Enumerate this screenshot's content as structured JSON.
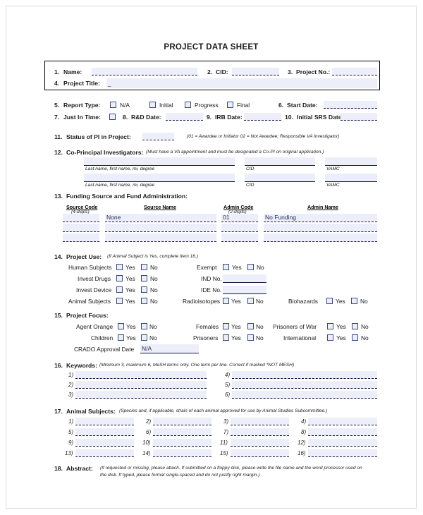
{
  "document": {
    "title": "PROJECT DATA SHEET"
  },
  "colors": {
    "field_fill": "#eceffa",
    "rule": "#14143c",
    "checkbox_border": "#3b4a7a",
    "page_border": "#dadada"
  },
  "header_box": {
    "item1": {
      "number": "1.",
      "label": "Name:",
      "value": ""
    },
    "item2": {
      "number": "2.",
      "label": "CID:",
      "value": ""
    },
    "item3": {
      "number": "3.",
      "label": "Project No.:",
      "value": ""
    },
    "item4": {
      "number": "4.",
      "label": "Project Title:",
      "value": "_"
    }
  },
  "item5": {
    "number": "5.",
    "label": "Report Type:",
    "options": [
      {
        "label": "N/A",
        "checked": false
      },
      {
        "label": "Initial",
        "checked": false
      },
      {
        "label": "Progress",
        "checked": false
      },
      {
        "label": "Final",
        "checked": false
      }
    ]
  },
  "item6": {
    "number": "6.",
    "label": "Start Date:",
    "value": ""
  },
  "item7": {
    "number": "7.",
    "label": "Just In Time:",
    "checked": false
  },
  "item8": {
    "number": "8.",
    "label": "R&D Date:",
    "value": ""
  },
  "item9": {
    "number": "9.",
    "label": "IRB Date:",
    "value": ""
  },
  "item10": {
    "number": "10.",
    "label": "Initial SRS Date:",
    "value": ""
  },
  "item11": {
    "number": "11.",
    "label": "Status of PI in Project:",
    "value": "",
    "note": "(01 = Awardee or Initiator 02 = Not Awardee; Responsible VA Investigator)"
  },
  "item12": {
    "number": "12.",
    "label": "Co-Principal Investigators:",
    "note": "(Must have a VA appointment and must be designated a Co-PI on original application.)",
    "captions": {
      "name": "Last name, first name, mi, degree",
      "cid": "CID",
      "vamc": "VAMC"
    },
    "rows": [
      {
        "name": "",
        "cid": "",
        "vamc": ""
      },
      {
        "name": "",
        "cid": "",
        "vamc": ""
      }
    ]
  },
  "item13": {
    "number": "13.",
    "label": "Funding Source and Fund Administration:",
    "headers": {
      "source_code": "Source Code",
      "source_code_sub": "(4-digits)",
      "source_name": "Source Name",
      "admin_code": "Admin Code",
      "admin_code_sub": "(2-digits)",
      "admin_name": "Admin Name"
    },
    "rows": [
      {
        "source_code": "",
        "source_name": "None",
        "admin_code": "01",
        "admin_name": "No Funding"
      },
      {
        "source_code": "",
        "source_name": "",
        "admin_code": "",
        "admin_name": ""
      },
      {
        "source_code": "",
        "source_name": "",
        "admin_code": "",
        "admin_name": ""
      }
    ]
  },
  "item14": {
    "number": "14.",
    "label": "Project Use:",
    "note": "(If Animal Subject is Yes, complete Item 16.)",
    "yes": "Yes",
    "no": "No",
    "left_rows": [
      {
        "label": "Human Subjects",
        "yes": false,
        "no": false
      },
      {
        "label": "Invest Drugs",
        "yes": false,
        "no": false
      },
      {
        "label": "Invest Device",
        "yes": false,
        "no": false
      },
      {
        "label": "Animal Subjects",
        "yes": false,
        "no": false
      }
    ],
    "mid_rows": [
      {
        "label": "Exempt",
        "kind": "checkbox",
        "yes": false,
        "no": false
      },
      {
        "label": "IND No.",
        "kind": "field",
        "value": ""
      },
      {
        "label": "IDE No.",
        "kind": "field",
        "value": ""
      },
      {
        "label": "Radioisotopes",
        "kind": "checkbox",
        "yes": false,
        "no": false
      }
    ],
    "right_row": {
      "label": "Biohazards",
      "yes": false,
      "no": false
    }
  },
  "item15": {
    "number": "15.",
    "label": "Project Focus:",
    "yes": "Yes",
    "no": "No",
    "left_rows": [
      {
        "label": "Agent Orange"
      },
      {
        "label": "Children"
      }
    ],
    "mid_rows": [
      {
        "label": "Females"
      },
      {
        "label": "Prisoners"
      }
    ],
    "right_rows": [
      {
        "label": "Prisoners of War"
      },
      {
        "label": "International"
      }
    ],
    "crado": {
      "label": "CRADO Approval Date",
      "value": "N/A"
    }
  },
  "item16": {
    "number": "16.",
    "label": "Keywords:",
    "note": "(Minimum 3, maximum 6, MeSH terms only. One term per line. Correct if marked *NOT MESH)",
    "entries": [
      {
        "marker": "1)",
        "value": ""
      },
      {
        "marker": "2)",
        "value": ""
      },
      {
        "marker": "3)",
        "value": ""
      },
      {
        "marker": "4)",
        "value": ""
      },
      {
        "marker": "5)",
        "value": ""
      },
      {
        "marker": "6)",
        "value": ""
      }
    ]
  },
  "item17": {
    "number": "17.",
    "label": "Animal Subjects:",
    "note": "(Species and, if applicable, strain of each animal approved for use by Animal Studies Subcommittee.)",
    "entries": [
      {
        "marker": "1)",
        "value": ""
      },
      {
        "marker": "2)",
        "value": ""
      },
      {
        "marker": "3)",
        "value": ""
      },
      {
        "marker": "4)",
        "value": ""
      },
      {
        "marker": "5)",
        "value": ""
      },
      {
        "marker": "6)",
        "value": ""
      },
      {
        "marker": "7)",
        "value": ""
      },
      {
        "marker": "8)",
        "value": ""
      },
      {
        "marker": "9)",
        "value": ""
      },
      {
        "marker": "10)",
        "value": ""
      },
      {
        "marker": "11)",
        "value": ""
      },
      {
        "marker": "12)",
        "value": ""
      },
      {
        "marker": "13)",
        "value": ""
      },
      {
        "marker": "14)",
        "value": ""
      },
      {
        "marker": "15)",
        "value": ""
      },
      {
        "marker": "16)",
        "value": ""
      }
    ]
  },
  "item18": {
    "number": "18.",
    "label": "Abstract:",
    "note_line1": "(If requested or missing, please attach. If submitted on a floppy disk, please write the file name and the word processor used on",
    "note_line2": "the disk. If typed, please format single-spaced and do not justify right margin.)"
  }
}
